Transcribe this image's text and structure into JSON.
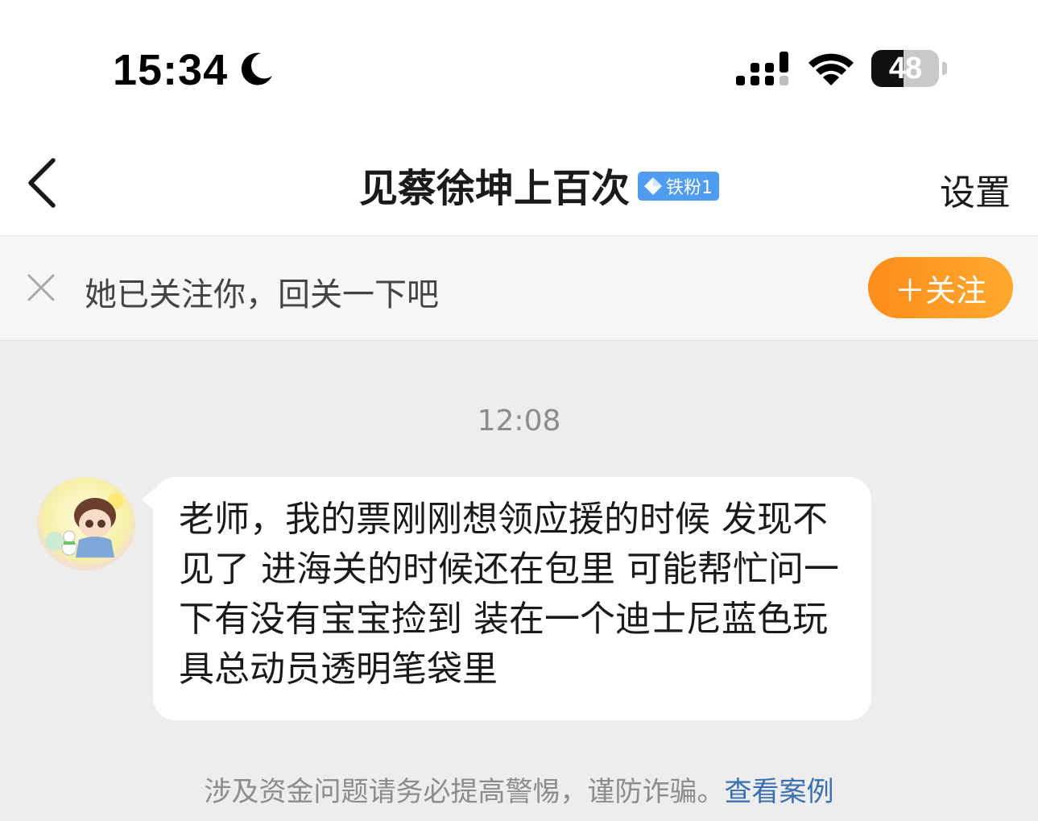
{
  "status_bar": {
    "time": "15:34",
    "battery_level": "48",
    "battery_fraction": 0.48,
    "icons": [
      "moon-icon",
      "cellular-signal-icon",
      "wifi-icon",
      "battery-icon"
    ]
  },
  "header": {
    "back_icon": "chevron-left-icon",
    "title": "见蔡徐坤上百次",
    "badge_label": "铁粉1",
    "badge_icon": "diamond-icon",
    "badge_color": "#4f9cf0",
    "settings_label": "设置"
  },
  "follow_banner": {
    "close_icon": "close-icon",
    "text": "她已关注你，回关一下吧",
    "button_label": "＋关注",
    "button_color": "#ff9a22"
  },
  "chat": {
    "timestamp": "12:08",
    "messages": [
      {
        "sender": "other",
        "avatar_icon": "avatar",
        "text": "老师，我的票刚刚想领应援的时候 发现不见了 进海关的时候还在包里 可能帮忙问一下有没有宝宝捡到 装在一个迪士尼蓝色玩具总动员透明笔袋里"
      }
    ]
  },
  "footer": {
    "warning_text": "涉及资金问题请务必提高警惕，谨防诈骗。",
    "link_text": "查看案例"
  }
}
